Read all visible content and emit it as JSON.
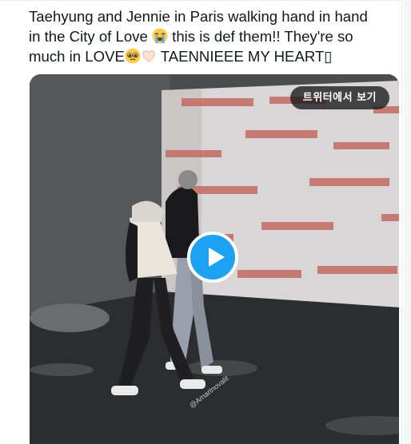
{
  "tweet": {
    "text_line1": "Taehyung and Jennie in Paris walking hand in hand",
    "text_line2_a": "in the City of Love ",
    "text_line2_b": " this is def them!! They're so",
    "text_line3_a": "much in LOVE",
    "text_line3_b": " TAENNIEEE MY HEART▯"
  },
  "media": {
    "view_on_twitter_label": "트위터에서 보기",
    "watermark": "@Amartnovalit",
    "play_icon": "play-icon"
  },
  "colors": {
    "text": "#14171a",
    "accent": "#1da1f2"
  }
}
